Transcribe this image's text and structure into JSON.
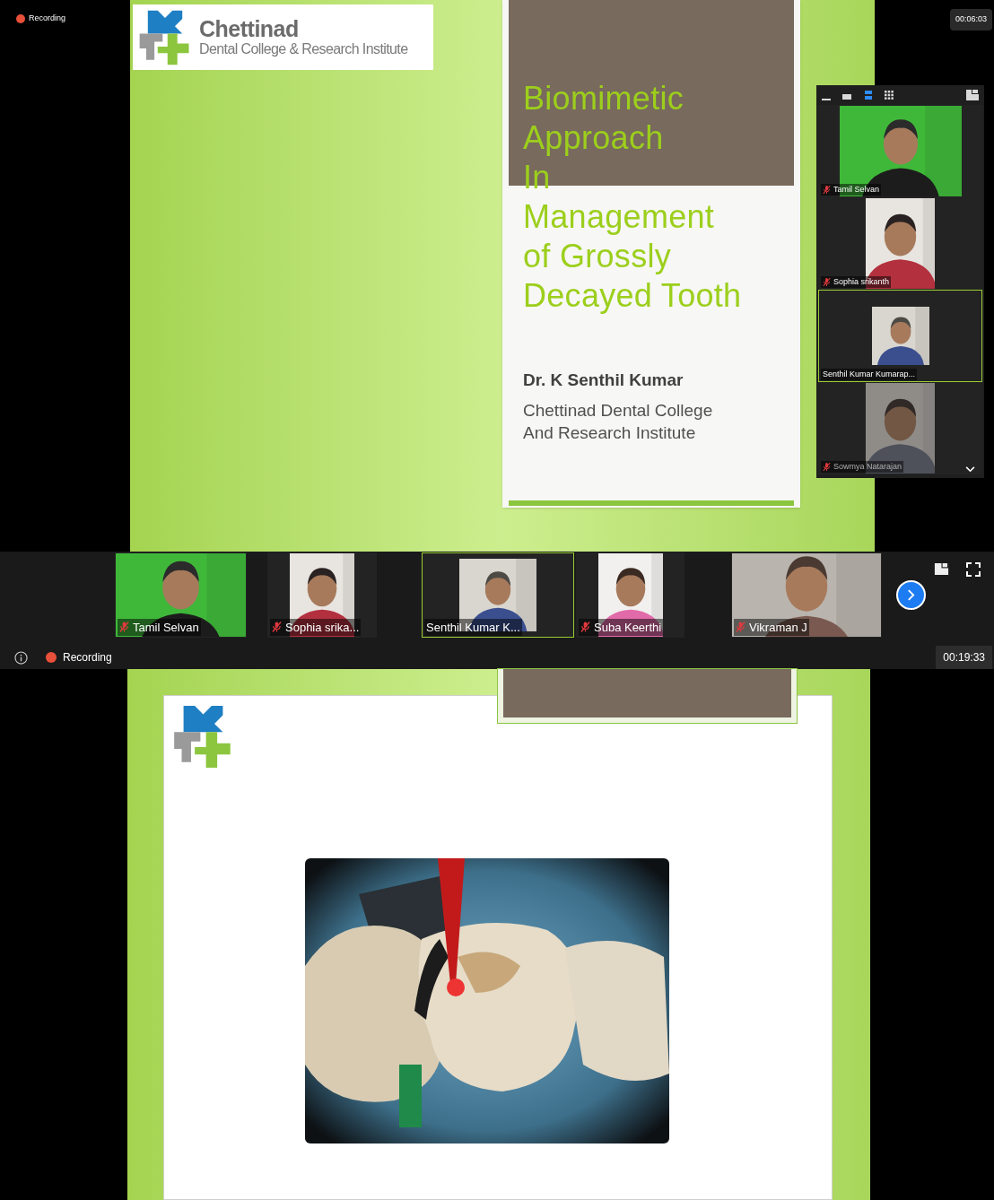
{
  "top_recording": {
    "label": "Recording"
  },
  "top_timer": "00:06:03",
  "slide_1": {
    "logo_name": "Chettinad",
    "logo_subtitle": "Dental College & Research Institute",
    "title_lines": [
      "Biomimetic",
      "Approach",
      "In",
      "Management",
      "of Grossly",
      "Decayed Tooth"
    ],
    "author": "Dr. K Senthil Kumar",
    "affiliation_lines": [
      "Chettinad Dental College",
      "And Research Institute"
    ]
  },
  "gallery_panel": {
    "view_buttons": [
      {
        "kind": "minimize",
        "selected": false
      },
      {
        "kind": "single",
        "selected": false
      },
      {
        "kind": "strip",
        "selected": true
      },
      {
        "kind": "grid",
        "selected": false
      }
    ],
    "tiles": [
      {
        "name": "Tamil Selvan",
        "muted": true,
        "active": false,
        "faded": false
      },
      {
        "name": "Sophia srikanth",
        "muted": true,
        "active": false,
        "faded": false
      },
      {
        "name": "Senthil Kumar Kumarap...",
        "muted": false,
        "active": true,
        "faded": false
      },
      {
        "name": "Sowmya Natarajan",
        "muted": true,
        "active": false,
        "faded": true
      }
    ]
  },
  "participant_strip": {
    "tiles": [
      {
        "name": "Tamil Selvan",
        "muted": true,
        "active": false
      },
      {
        "name": "Sophia srika...",
        "muted": true,
        "active": false
      },
      {
        "name": "Senthil Kumar K...",
        "muted": false,
        "active": true
      },
      {
        "name": "Suba Keerthi",
        "muted": true,
        "active": false
      },
      {
        "name": "Vikraman J",
        "muted": true,
        "active": false
      }
    ]
  },
  "meeting_bar": {
    "recording": "Recording",
    "timer": "00:19:33"
  }
}
